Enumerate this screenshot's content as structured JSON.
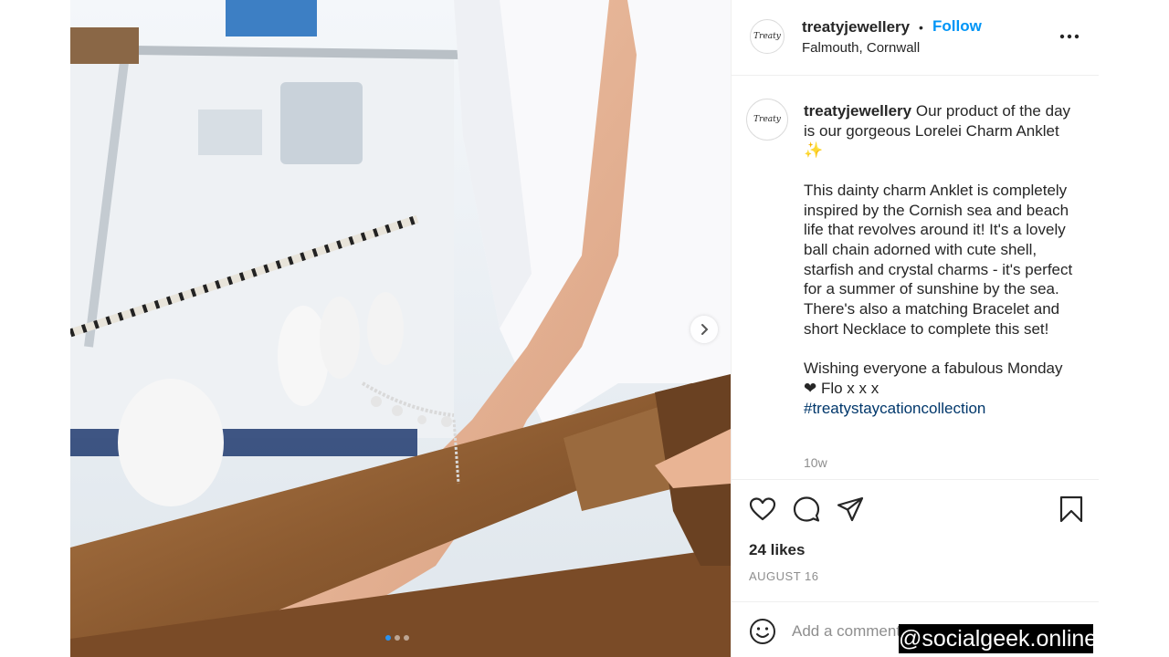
{
  "post": {
    "username": "treatyjewellery",
    "separator": "•",
    "follow_label": "Follow",
    "location": "Falmouth, Cornwall",
    "avatar_text": "Treaty",
    "more_icon": "more-horizontal-icon"
  },
  "caption": {
    "username": "treatyjewellery",
    "line1": " Our product of the day is our gorgeous Lorelei Charm Anklet",
    "emoji": "✨",
    "para2": "This dainty charm Anklet is completely inspired by the Cornish sea and beach life that revolves around it! It's a lovely ball chain adorned with cute shell, starfish and crystal charms - it's perfect for a summer of sunshine by the sea.",
    "para3": "There's also a matching Bracelet and short Necklace to complete this set!",
    "para4": "Wishing everyone a fabulous Monday",
    "para5": "❤ Flo x x x",
    "hashtag": "#treatystaycationcollection",
    "time_ago": "10w"
  },
  "actions": {
    "icons": [
      "heart-icon",
      "comment-icon",
      "share-icon",
      "bookmark-icon"
    ]
  },
  "likes": "24 likes",
  "date": "AUGUST 16",
  "comment": {
    "placeholder": "Add a comment...",
    "emoji_icon": "smiley-icon"
  },
  "carousel": {
    "slide_count": 3,
    "active_index": 0
  },
  "watermark": "@socialgeek.online",
  "colors": {
    "link_blue": "#0095f6",
    "hashtag": "#00376b",
    "text": "#262626",
    "muted": "#8e8e8e"
  }
}
